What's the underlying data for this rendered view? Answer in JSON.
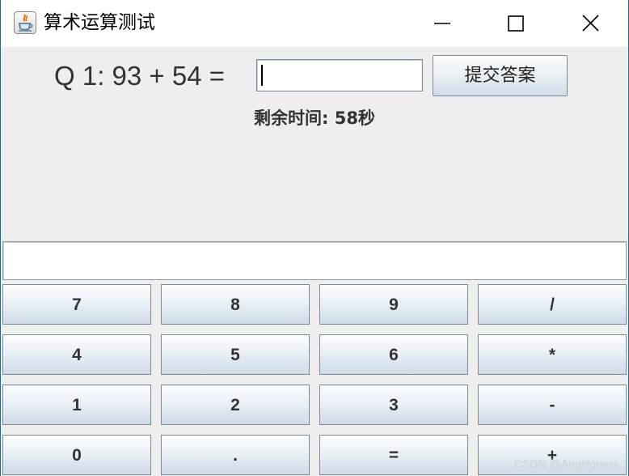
{
  "window": {
    "title": "算术运算测试"
  },
  "question": {
    "text": "Q 1: 93 + 54 ="
  },
  "answer": {
    "value": ""
  },
  "submit": {
    "label": "提交答案"
  },
  "timer": {
    "label": "剩余时间: ",
    "seconds": "58",
    "unit": "秒"
  },
  "display": {
    "value": ""
  },
  "keys": [
    [
      "7",
      "8",
      "9",
      "/"
    ],
    [
      "4",
      "5",
      "6",
      "*"
    ],
    [
      "1",
      "2",
      "3",
      "-"
    ],
    [
      "0",
      ".",
      "=",
      "+"
    ]
  ],
  "watermark": "CSDN @Angeloowo"
}
